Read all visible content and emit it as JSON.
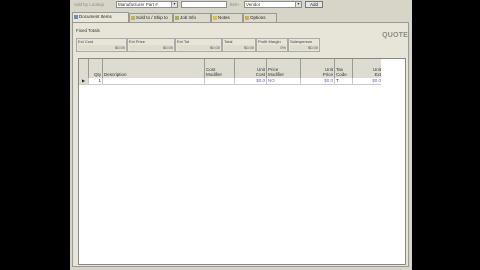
{
  "topbar": {
    "lookup_label": "Add by Lookup",
    "item_type_value": "Manufacturer Part #",
    "search_value": "",
    "type_label": "Item",
    "type_value": "Vendor",
    "add_label": "Add"
  },
  "tabs": [
    {
      "label": "Document Items",
      "icon_color": "#6a8fbf"
    },
    {
      "label": "Sold to / Ship to",
      "icon_color": "#c9b24a"
    },
    {
      "label": "Job Info",
      "icon_color": "#a0b34e"
    },
    {
      "label": "Notes",
      "icon_color": "#d8c040"
    },
    {
      "label": "Options",
      "icon_color": "#c9b24a"
    }
  ],
  "totals": {
    "section_label": "Fixed Totals",
    "doc_type": "QUOTE",
    "cells": [
      {
        "label": "Ext Cost",
        "value": "$0.00"
      },
      {
        "label": "Ext Price",
        "value": "$0.00"
      },
      {
        "label": "Ext Tot",
        "value": "$0.00"
      },
      {
        "label": "Total",
        "value": "$0.00"
      },
      {
        "label": "Profit Margin",
        "value": "0%"
      },
      {
        "label": "Salesperson",
        "value": "$0.00"
      }
    ]
  },
  "grid": {
    "headers": [
      "",
      "Qty",
      "Description",
      "Cost Modifier",
      "Unit Cost",
      "Price Modifier",
      "Unit Price",
      "Tax Code",
      "Unit Ext"
    ],
    "row": {
      "indicator": "▶",
      "qty": "1",
      "description": "",
      "cost_modifier": "",
      "unit_cost": "$0.0",
      "price_modifier": "NO",
      "unit_price": "$0.0",
      "tax_code": "T",
      "unit_ext": "$0.0"
    }
  }
}
